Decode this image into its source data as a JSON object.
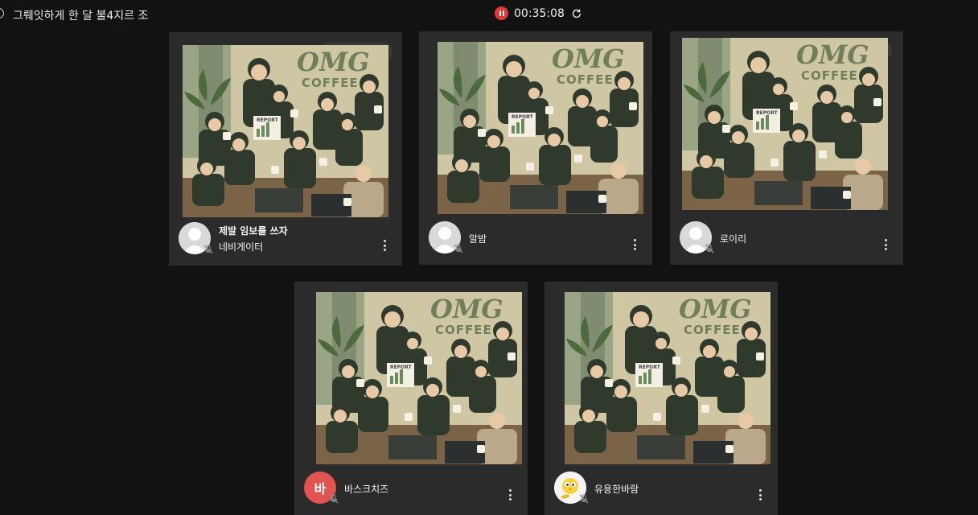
{
  "header": {
    "room_title": "그뤠잇하게 한 달 불4지르 조",
    "timer": "00:35:08",
    "icons": [
      "radio-icon",
      "record-pause-icon",
      "refresh-icon"
    ]
  },
  "poster": {
    "brand_line1": "OMG",
    "brand_line2": "COFFEE",
    "report_label": "REPORT"
  },
  "participants": [
    {
      "name": "제발 임보를 쓰자",
      "role": "네비게이터",
      "avatar": "default",
      "muted": true
    },
    {
      "name": "알밤",
      "role": "",
      "avatar": "default",
      "muted": true
    },
    {
      "name": "로이리",
      "role": "",
      "avatar": "default",
      "muted": true
    },
    {
      "name": "바스크치즈",
      "role": "",
      "avatar": "letter",
      "avatar_letter": "바",
      "avatar_color": "#e2544f",
      "muted": true
    },
    {
      "name": "유용한바람",
      "role": "",
      "avatar": "bird-image",
      "muted": true
    }
  ],
  "colors": {
    "background": "#121212",
    "tile": "#2b2b2b",
    "record": "#e5383b"
  }
}
